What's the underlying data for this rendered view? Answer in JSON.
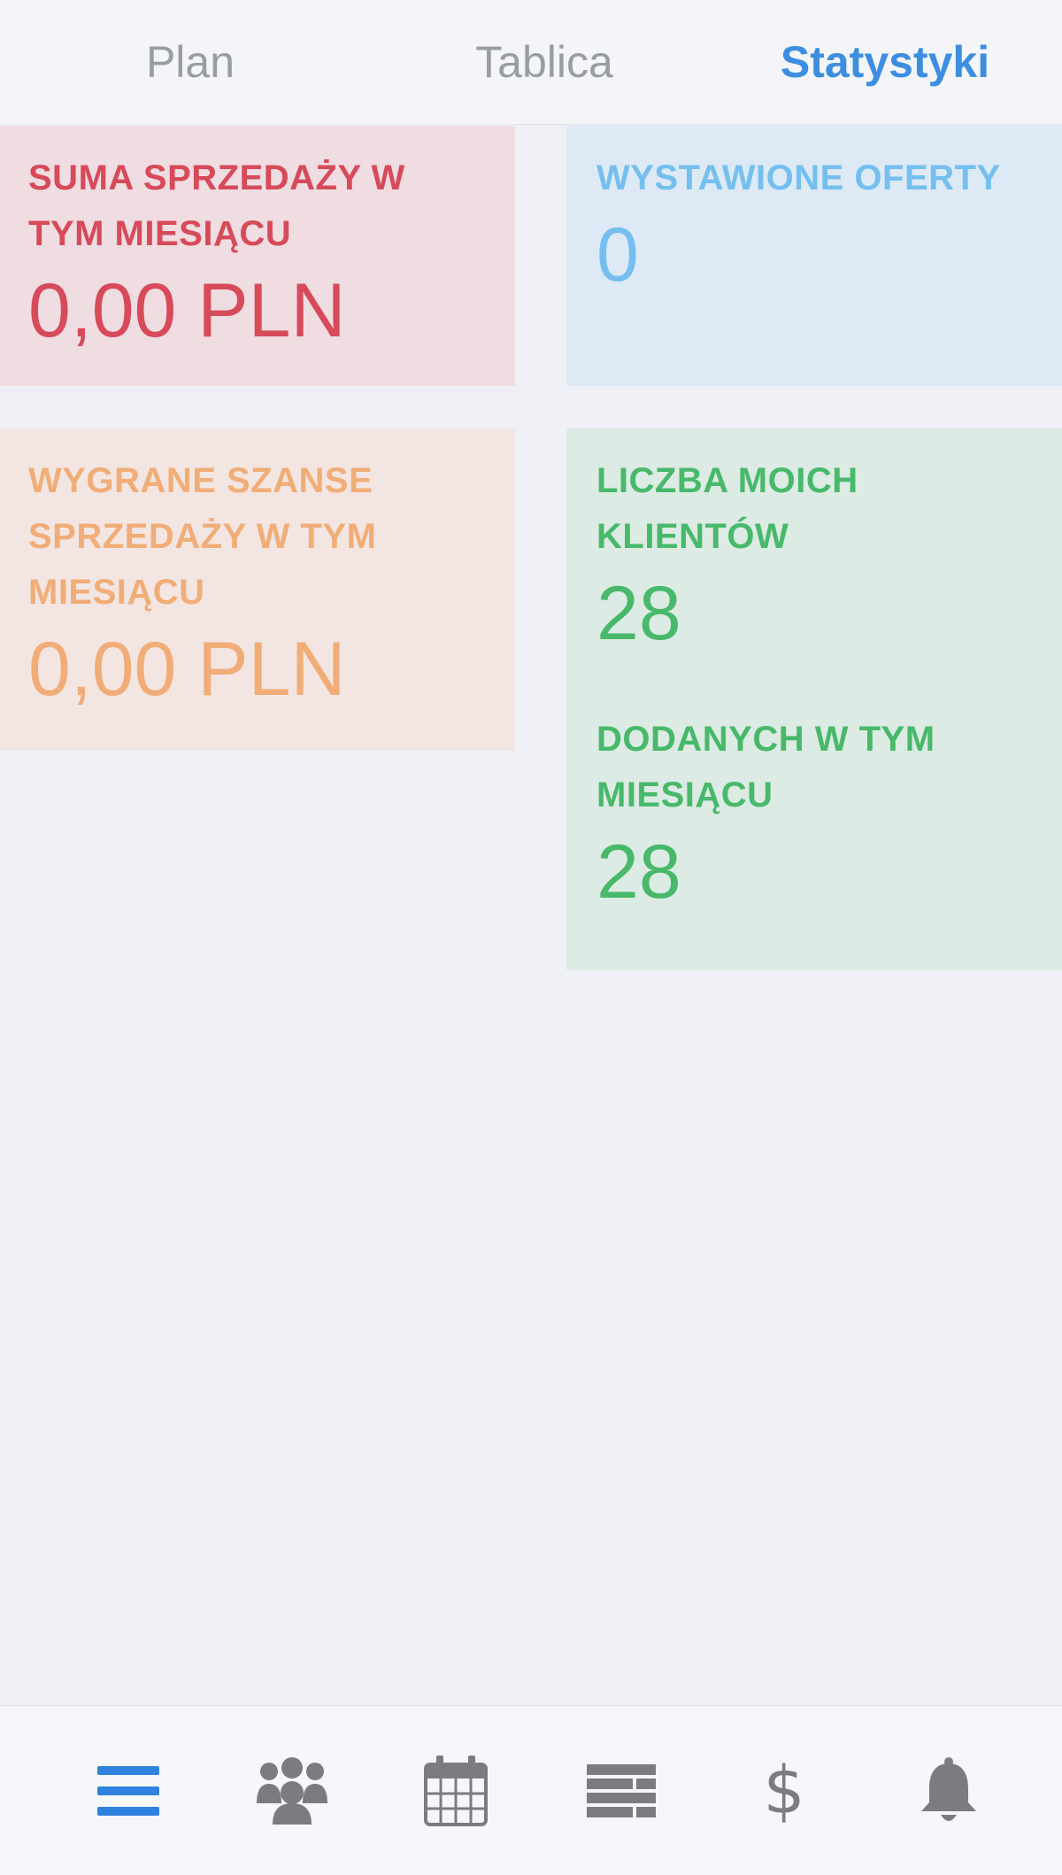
{
  "tabs": [
    {
      "label": "Plan",
      "active": false
    },
    {
      "label": "Tablica",
      "active": false
    },
    {
      "label": "Statystyki",
      "active": true
    }
  ],
  "cards": {
    "sales_sum": {
      "label": "SUMA SPRZEDAŻY W TYM MIESIĄCU",
      "value": "0,00 PLN",
      "color": "#d74a5a"
    },
    "offers": {
      "label": "WYSTAWIONE OFERTY",
      "value": "0",
      "color": "#74bff0"
    },
    "won": {
      "label": "WYGRANE SZANSE SPRZEDAŻY W TYM MIESIĄCU",
      "value": "0,00 PLN",
      "color": "#f1ad78"
    },
    "clients": {
      "label": "LICZBA MOICH KLIENTÓW",
      "value": "28",
      "added_label": "DODANYCH W TYM MIESIĄCU",
      "added_value": "28",
      "color": "#48b96a"
    }
  },
  "bottom_nav": [
    {
      "icon": "menu-icon",
      "active": true
    },
    {
      "icon": "users-icon",
      "active": false
    },
    {
      "icon": "calendar-icon",
      "active": false
    },
    {
      "icon": "list-icon",
      "active": false
    },
    {
      "icon": "dollar-icon",
      "glyph": "$",
      "active": false
    },
    {
      "icon": "bell-icon",
      "active": false
    }
  ],
  "colors": {
    "accent": "#3d8ee0",
    "inactive_tab": "#9a9ca3",
    "icon_gray": "#7b7c80",
    "background": "#eff0f5"
  }
}
